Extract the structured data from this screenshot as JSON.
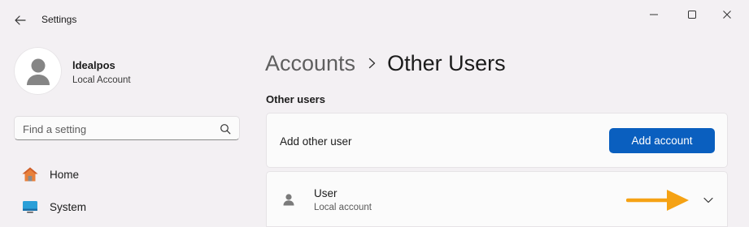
{
  "window": {
    "app_title": "Settings"
  },
  "sidebar": {
    "profile": {
      "name": "ldealpos",
      "account_type": "Local Account"
    },
    "search": {
      "placeholder": "Find a setting"
    },
    "items": [
      {
        "label": "Home",
        "icon": "home-icon"
      },
      {
        "label": "System",
        "icon": "system-icon"
      }
    ]
  },
  "main": {
    "breadcrumb": {
      "parent": "Accounts",
      "current": "Other Users"
    },
    "section_label": "Other users",
    "add_user": {
      "label": "Add other user",
      "button_label": "Add account"
    },
    "users": [
      {
        "name": "User",
        "type": "Local account"
      }
    ]
  },
  "colors": {
    "accent": "#0a5fbf",
    "annotation_arrow": "#f5a214",
    "background": "#f3f0f3",
    "card": "#fbfbfb"
  }
}
